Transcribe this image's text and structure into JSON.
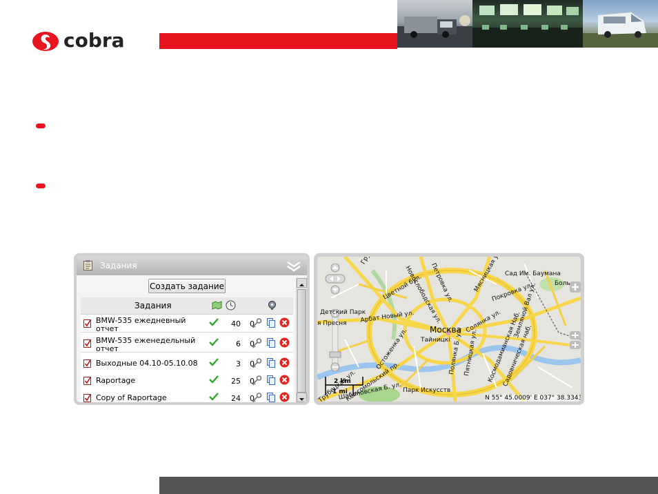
{
  "brand": {
    "logo_text": "cobra",
    "accent": "#e8141f"
  },
  "header": {
    "photos": [
      "truck-photo",
      "control-room-photo",
      "van-photo"
    ]
  },
  "tasks_widget": {
    "title": "Задания",
    "create_button": "Создать задание",
    "columns": {
      "name": "Задания",
      "status_icon": "map-icon",
      "time_icon": "clock-icon",
      "settings_icon": "gear-icon"
    },
    "rows": [
      {
        "name": "BMW-535 ежедневный отчет",
        "count_a": "40",
        "count_b": "0"
      },
      {
        "name": "BMW-535 еженедельный отчет",
        "count_a": "6",
        "count_b": "0"
      },
      {
        "name": "Выходные 04.10-05.10.08",
        "count_a": "3",
        "count_b": "0"
      },
      {
        "name": "Raportage",
        "count_a": "25",
        "count_b": "0"
      },
      {
        "name": "Copy of Raportage",
        "count_a": "24",
        "count_b": "0"
      }
    ]
  },
  "map_widget": {
    "city": "Москва",
    "labels": [
      "Грузинская",
      "Новослободская ул.",
      "Петровка ул.",
      "Мясницкая ул.",
      "Сад Им. Баумана",
      "Боль",
      "Покровка ул.",
      "Цветной бул.",
      "Детский Парк",
      "Арбат Новый ул.",
      "я Пресня",
      "Тайницкі",
      "Солянка ул.",
      "Земляной Вал ул.",
      "Пятницкая ул.",
      "Полянка Б. ул.",
      "Космодамианская Наб.",
      "Садовническая наб.",
      "Парк Искусств",
      "Комсомольский пр.",
      "Остоженка ул.",
      "Трубецкая ул.",
      "Шаболовская Б. ул."
    ],
    "scale": {
      "km": "2 km",
      "mi": "1 mi"
    },
    "coords": "N 55° 45.0009' E 037° 38.3343'"
  },
  "footer": {}
}
